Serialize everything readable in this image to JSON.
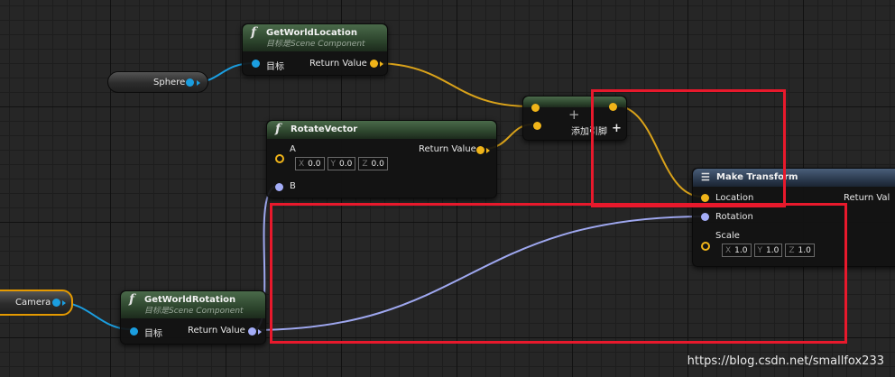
{
  "nodes": {
    "get_world_location": {
      "func_glyph": "f",
      "title": "GetWorldLocation",
      "subtitle": "目标是Scene Component",
      "in_target": "目标",
      "out_return": "Return Value"
    },
    "rotate_vector": {
      "func_glyph": "f",
      "title": "RotateVector",
      "in_a": "A",
      "out_return": "Return Value",
      "in_b": "B",
      "a_vector": {
        "x_label": "X",
        "x": "0.0",
        "y_label": "Y",
        "y": "0.0",
        "z_label": "Z",
        "z": "0.0"
      }
    },
    "get_world_rotation": {
      "func_glyph": "f",
      "title": "GetWorldRotation",
      "subtitle": "目标是Scene Component",
      "in_target": "目标",
      "out_return": "Return Value"
    },
    "add": {
      "symbol": "+",
      "add_pin_label": "添加引脚",
      "add_pin_plus": "+"
    },
    "make_transform": {
      "title": "Make Transform",
      "in_location": "Location",
      "in_rotation": "Rotation",
      "in_scale": "Scale",
      "out_return": "Return Val",
      "scale_vector": {
        "x_label": "X",
        "x": "1.0",
        "y_label": "Y",
        "y": "1.0",
        "z_label": "Z",
        "z": "1.0"
      }
    }
  },
  "variables": {
    "sphere": "Sphere",
    "camera": "Camera"
  },
  "colors": {
    "exec_object": "#1b9ee0",
    "vector": "#f0b419",
    "rotator": "#a4adf8",
    "highlight": "#e8192c",
    "selected": "#e59a00"
  },
  "watermark": "https://blog.csdn.net/smallfox233"
}
